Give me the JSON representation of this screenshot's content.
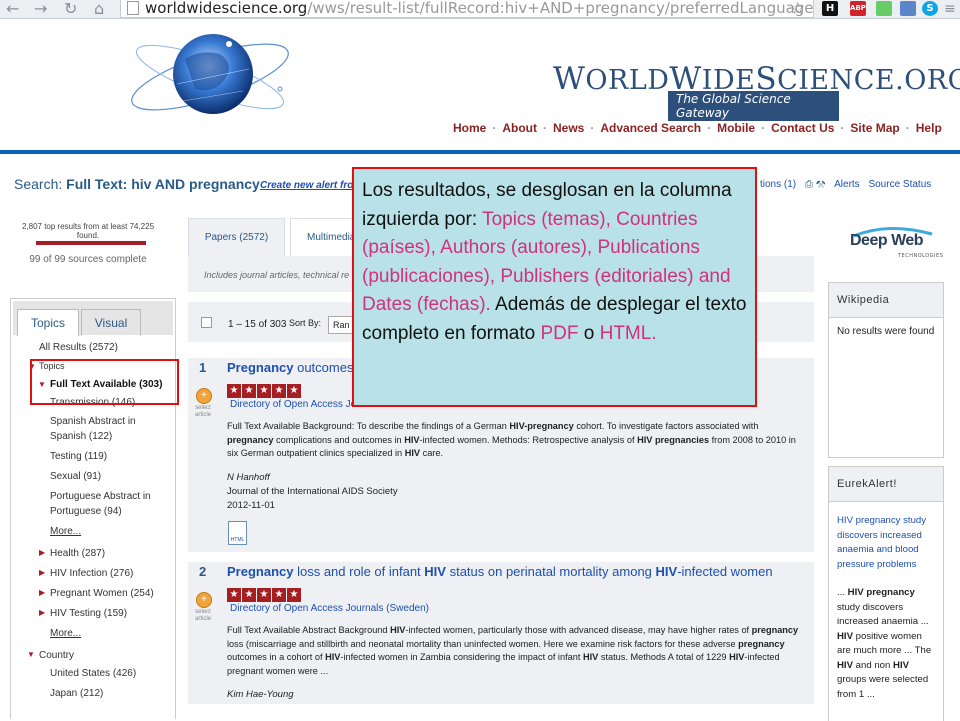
{
  "browser": {
    "url_host": "worldwidescience.org",
    "url_path": "/wws/result-list/fullRecord:hiv+AND+pregnancy/preferredLanguage",
    "ext_h": "H",
    "ext_abp": "ABP"
  },
  "header": {
    "logo_w": "W",
    "logo_orld": "ORLD",
    "logo_w2": "W",
    "logo_ide": "IDE",
    "logo_s": "S",
    "logo_cience": "CIENCE",
    "logo_org": ".ORG",
    "tagline": "The Global Science Gateway",
    "nav": [
      "Home",
      "About",
      "News",
      "Advanced Search",
      "Mobile",
      "Contact Us",
      "Site Map",
      "Help"
    ]
  },
  "search": {
    "label": "Search:",
    "query": "Full Text: hiv AND pregnancy",
    "create_alert": "Create new alert from",
    "actions": "tions (1)",
    "alerts": "Alerts",
    "source_status": "Source Status"
  },
  "stats": {
    "found": "2,807 top results from at least 74,225 found.",
    "sources": "99 of 99 sources complete",
    "progress": 100
  },
  "facets": {
    "tab_topics": "Topics",
    "tab_visual": "Visual",
    "all_results": "All Results (2572)",
    "topics_heading": "Topics",
    "full_text": "Full Text Available (303)",
    "transmission": "Transmission (146)",
    "spanish_abs_1": "Spanish Abstract in",
    "spanish_abs_2": "Spanish (122)",
    "testing": "Testing (119)",
    "sexual": "Sexual (91)",
    "portuguese_1": "Portuguese Abstract in",
    "portuguese_2": "Portuguese (94)",
    "more": "More...",
    "health": "Health (287)",
    "hiv_infection": "HIV Infection (276)",
    "pregnant_women": "Pregnant Women (254)",
    "hiv_testing": "HIV Testing (159)",
    "more2": "More...",
    "country": "Country",
    "us": "United States (426)",
    "japan": "Japan (212)"
  },
  "tabs": {
    "papers": "Papers (2572)",
    "multimedia": "Multimedia"
  },
  "includes": "Includes journal articles, technical re",
  "results_bar": {
    "count": "1 – 15 of 303",
    "sort_label": "Sort By:",
    "sort_value": "Ran"
  },
  "results": [
    {
      "num": "1",
      "title_b": "Pregnancy",
      "title_rest": " outcomes i",
      "select": "select article",
      "source": "Directory of Open Access Jo",
      "author": "N Hanhoff",
      "journal": "Journal of the International AIDS Society",
      "date": "2012-11-01"
    },
    {
      "num": "2",
      "title_b1": "Pregnancy",
      "title_t1": " loss and role of infant ",
      "title_b2": "HIV",
      "title_t2": " status on perinatal mortality among ",
      "title_b3": "HIV",
      "title_t3": "-infected women",
      "select": "select article",
      "source": "Directory of Open Access Journals (Sweden)",
      "author": "Kim Hae-Young"
    }
  ],
  "widgets": {
    "deep_web": "Deep Web",
    "deep_web_sub": "TECHNOLOGIES",
    "wiki_title": "Wikipedia",
    "wiki_body": "No results were found",
    "eureka_title": "EurekAlert!",
    "eureka_link": "HIV pregnancy study discovers increased anaemia and blood pressure problems",
    "eureka_s1": "... ",
    "eureka_b1": "HIV pregnancy",
    "eureka_s2": " study discovers increased anaemia ... ",
    "eureka_b2": "HIV",
    "eureka_s3": " positive women are much more ... The ",
    "eureka_b3": "HIV",
    "eureka_s4": " and non ",
    "eureka_b4": "HIV",
    "eureka_s5": " groups were selected from 1 ..."
  },
  "callout": {
    "t1": "Los resultados, se desglosan en la columna izquierda por: ",
    "h1": "Topics (temas), Countries (países), Authors (autores), Publications (publicaciones), Publishers (editoriales) and Dates (fechas).",
    "t2": " Además de desplegar el texto completo en formato ",
    "h2": "PDF",
    "t3": " o ",
    "h3": "HTML.",
    "colors": {
      "highlight": "#d2317b",
      "border": "#e01010",
      "background": "#b9e1e8"
    }
  }
}
